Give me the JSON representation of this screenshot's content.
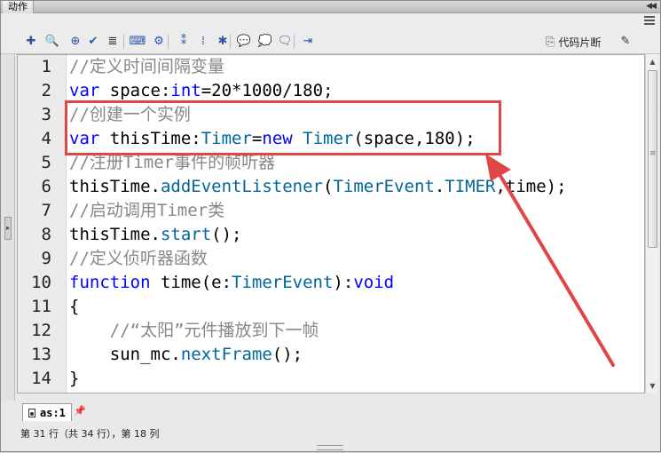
{
  "window": {
    "title_tab": "动作"
  },
  "toolbar": {
    "buttons": [
      {
        "name": "add-statement-icon",
        "glyph": "✚"
      },
      {
        "name": "find-icon",
        "glyph": "🔍"
      },
      {
        "name": "target-path-icon",
        "glyph": "⊕"
      },
      {
        "name": "check-syntax-icon",
        "glyph": "✔"
      },
      {
        "name": "auto-format-icon",
        "glyph": "≣"
      },
      {
        "name": "code-hint-icon",
        "glyph": "⌨"
      },
      {
        "name": "debug-options-icon",
        "glyph": "⚙"
      },
      {
        "name": "collapse-between-braces-icon",
        "glyph": "⁑"
      },
      {
        "name": "collapse-selection-icon",
        "glyph": "⁞"
      },
      {
        "name": "expand-all-icon",
        "glyph": "✱"
      },
      {
        "name": "apply-block-comment-icon",
        "glyph": "💬"
      },
      {
        "name": "apply-line-comment-icon",
        "glyph": "💭"
      },
      {
        "name": "remove-comment-icon",
        "glyph": "🗨"
      },
      {
        "name": "show-hide-toolbox-icon",
        "glyph": "⇥"
      }
    ],
    "snippets_label": "代码片断",
    "wand_glyph": "✎"
  },
  "editor": {
    "lines": [
      {
        "n": "1",
        "parts": [
          {
            "t": "//定义时间间隔变量",
            "s": "c"
          }
        ]
      },
      {
        "n": "2",
        "parts": [
          {
            "t": "var",
            "s": "k"
          },
          {
            "t": " space:",
            "s": ""
          },
          {
            "t": "int",
            "s": "k"
          },
          {
            "t": "=20*1000/180;",
            "s": ""
          }
        ]
      },
      {
        "n": "3",
        "parts": [
          {
            "t": "//创建一个实例",
            "s": "c"
          }
        ]
      },
      {
        "n": "4",
        "parts": [
          {
            "t": "var",
            "s": "k"
          },
          {
            "t": " thisTime:",
            "s": ""
          },
          {
            "t": "Timer",
            "s": "t"
          },
          {
            "t": "=",
            "s": ""
          },
          {
            "t": "new",
            "s": "k"
          },
          {
            "t": " ",
            "s": ""
          },
          {
            "t": "Timer",
            "s": "t"
          },
          {
            "t": "(space,180);",
            "s": ""
          }
        ]
      },
      {
        "n": "5",
        "parts": [
          {
            "t": "//注册Timer事件的帧听器",
            "s": "c"
          }
        ]
      },
      {
        "n": "6",
        "parts": [
          {
            "t": "thisTime.",
            "s": ""
          },
          {
            "t": "addEventListener",
            "s": "m"
          },
          {
            "t": "(",
            "s": ""
          },
          {
            "t": "TimerEvent",
            "s": "t"
          },
          {
            "t": ".",
            "s": ""
          },
          {
            "t": "TIMER",
            "s": "m"
          },
          {
            "t": ",time);",
            "s": ""
          }
        ]
      },
      {
        "n": "7",
        "parts": [
          {
            "t": "//启动调用Timer类",
            "s": "c"
          }
        ]
      },
      {
        "n": "8",
        "parts": [
          {
            "t": "thisTime.",
            "s": ""
          },
          {
            "t": "start",
            "s": "m"
          },
          {
            "t": "();",
            "s": ""
          }
        ]
      },
      {
        "n": "9",
        "parts": [
          {
            "t": "//定义侦听器函数",
            "s": "c"
          }
        ]
      },
      {
        "n": "10",
        "parts": [
          {
            "t": "function",
            "s": "k"
          },
          {
            "t": " time(e:",
            "s": ""
          },
          {
            "t": "TimerEvent",
            "s": "t"
          },
          {
            "t": "):",
            "s": ""
          },
          {
            "t": "void",
            "s": "k"
          }
        ]
      },
      {
        "n": "11",
        "parts": [
          {
            "t": "{",
            "s": ""
          }
        ]
      },
      {
        "n": "12",
        "parts": [
          {
            "t": "    ",
            "s": ""
          },
          {
            "t": "//“太阳”元件播放到下一帧",
            "s": "c"
          }
        ]
      },
      {
        "n": "13",
        "parts": [
          {
            "t": "    sun_mc.",
            "s": ""
          },
          {
            "t": "nextFrame",
            "s": "m"
          },
          {
            "t": "();",
            "s": ""
          }
        ]
      },
      {
        "n": "14",
        "parts": [
          {
            "t": "}",
            "s": ""
          }
        ]
      }
    ]
  },
  "file_tab": {
    "label": "as:1"
  },
  "status": {
    "text": "第 31 行（共 34 行），第 18 列"
  },
  "colors": {
    "highlight": "#e04646",
    "comment": "#878787",
    "keyword": "#0000ff",
    "type": "#006699"
  }
}
